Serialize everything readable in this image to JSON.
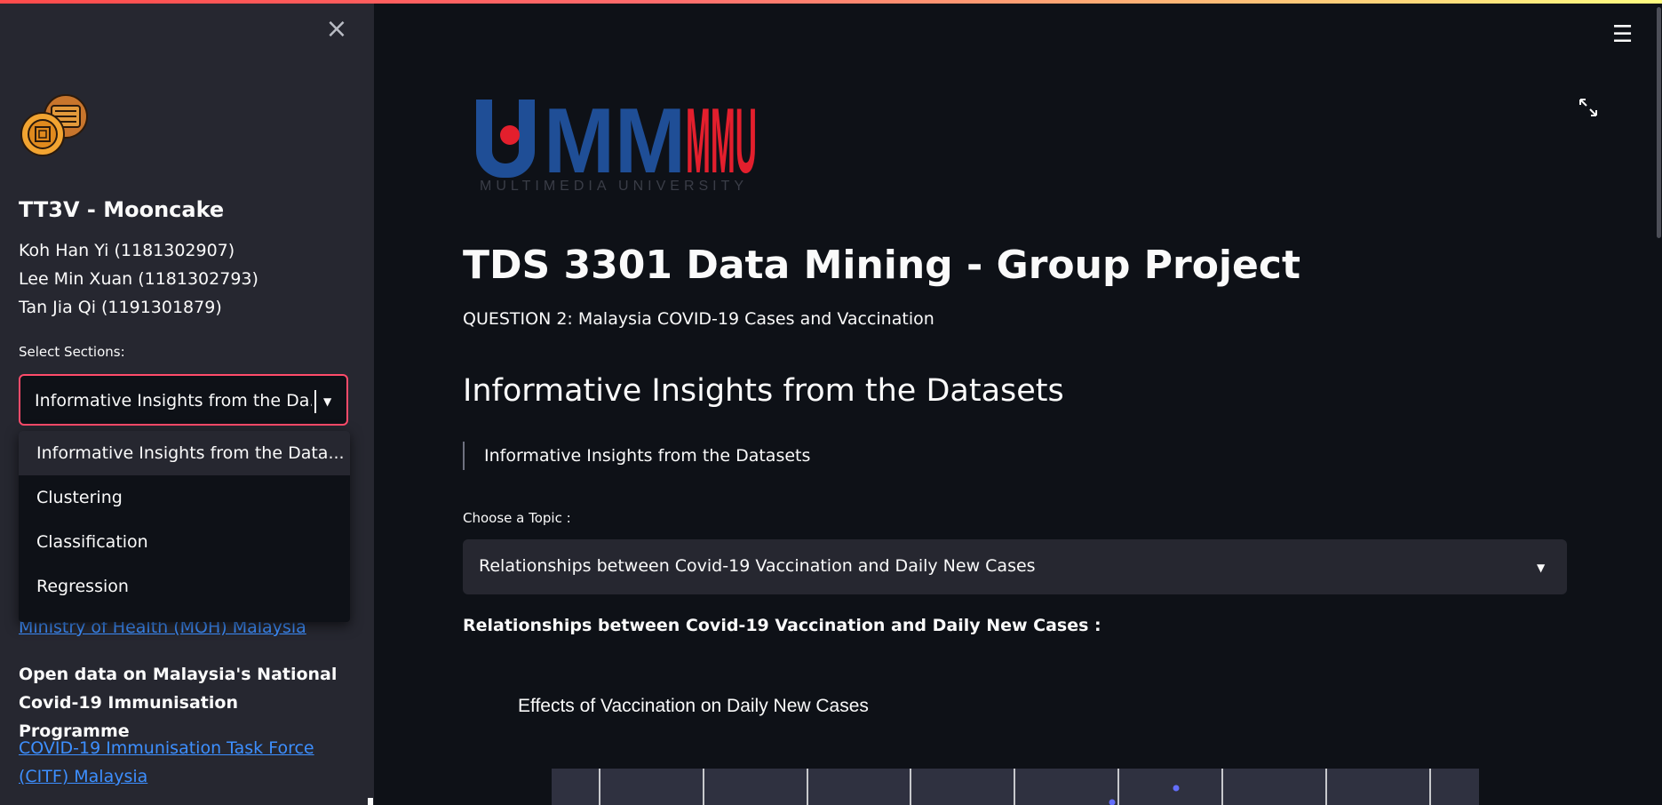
{
  "sidebar": {
    "close_glyph": "×",
    "team_name": "TT3V - Mooncake",
    "members": [
      "Koh Han Yi (1181302907)",
      "Lee Min Xuan (1181302793)",
      "Tan Jia Qi (1191301879)"
    ],
    "select_label": "Select Sections:",
    "selected_value": "Informative Insights from the Da...",
    "dropdown_options": [
      "Informative Insights from the Data...",
      "Clustering",
      "Classification",
      "Regression"
    ],
    "link_moh": "Ministry of Health (MOH) Malaysia",
    "bold_text": "Open data on Malaysia's National Covid-19 Immunisation Programme",
    "link_citf_line1": "COVID-19 Immunisation Task Force",
    "link_citf_line2": "(CITF) Malaysia"
  },
  "header": {
    "menu_glyph": "☰"
  },
  "main": {
    "logo_text": "MMU",
    "logo_subtext": "MULTIMEDIA UNIVERSITY",
    "title": "TDS 3301 Data Mining - Group Project",
    "subtitle": "QUESTION 2: Malaysia COVID-19 Cases and Vaccination",
    "section_title": "Informative Insights from the Datasets",
    "quote": "Informative Insights from the Datasets",
    "topic_label": "Choose a Topic :",
    "topic_value": "Relationships between Covid-19 Vaccination and Daily New Cases",
    "bold_heading": "Relationships between Covid-19 Vaccination and Daily New Cases :",
    "chart_title": "Effects of Vaccination on Daily New Cases"
  },
  "colors": {
    "accent": "#ff4b6a",
    "link": "#3d8fff",
    "sidebar_bg": "#262730",
    "main_bg": "#0e1117",
    "point": "#636efa",
    "mmu_blue": "#1f4e96",
    "mmu_red": "#e31f2d"
  },
  "icons": [
    "close-icon",
    "mooncake-logo-icon",
    "chevron-down-icon",
    "hamburger-menu-icon",
    "expand-icon"
  ]
}
